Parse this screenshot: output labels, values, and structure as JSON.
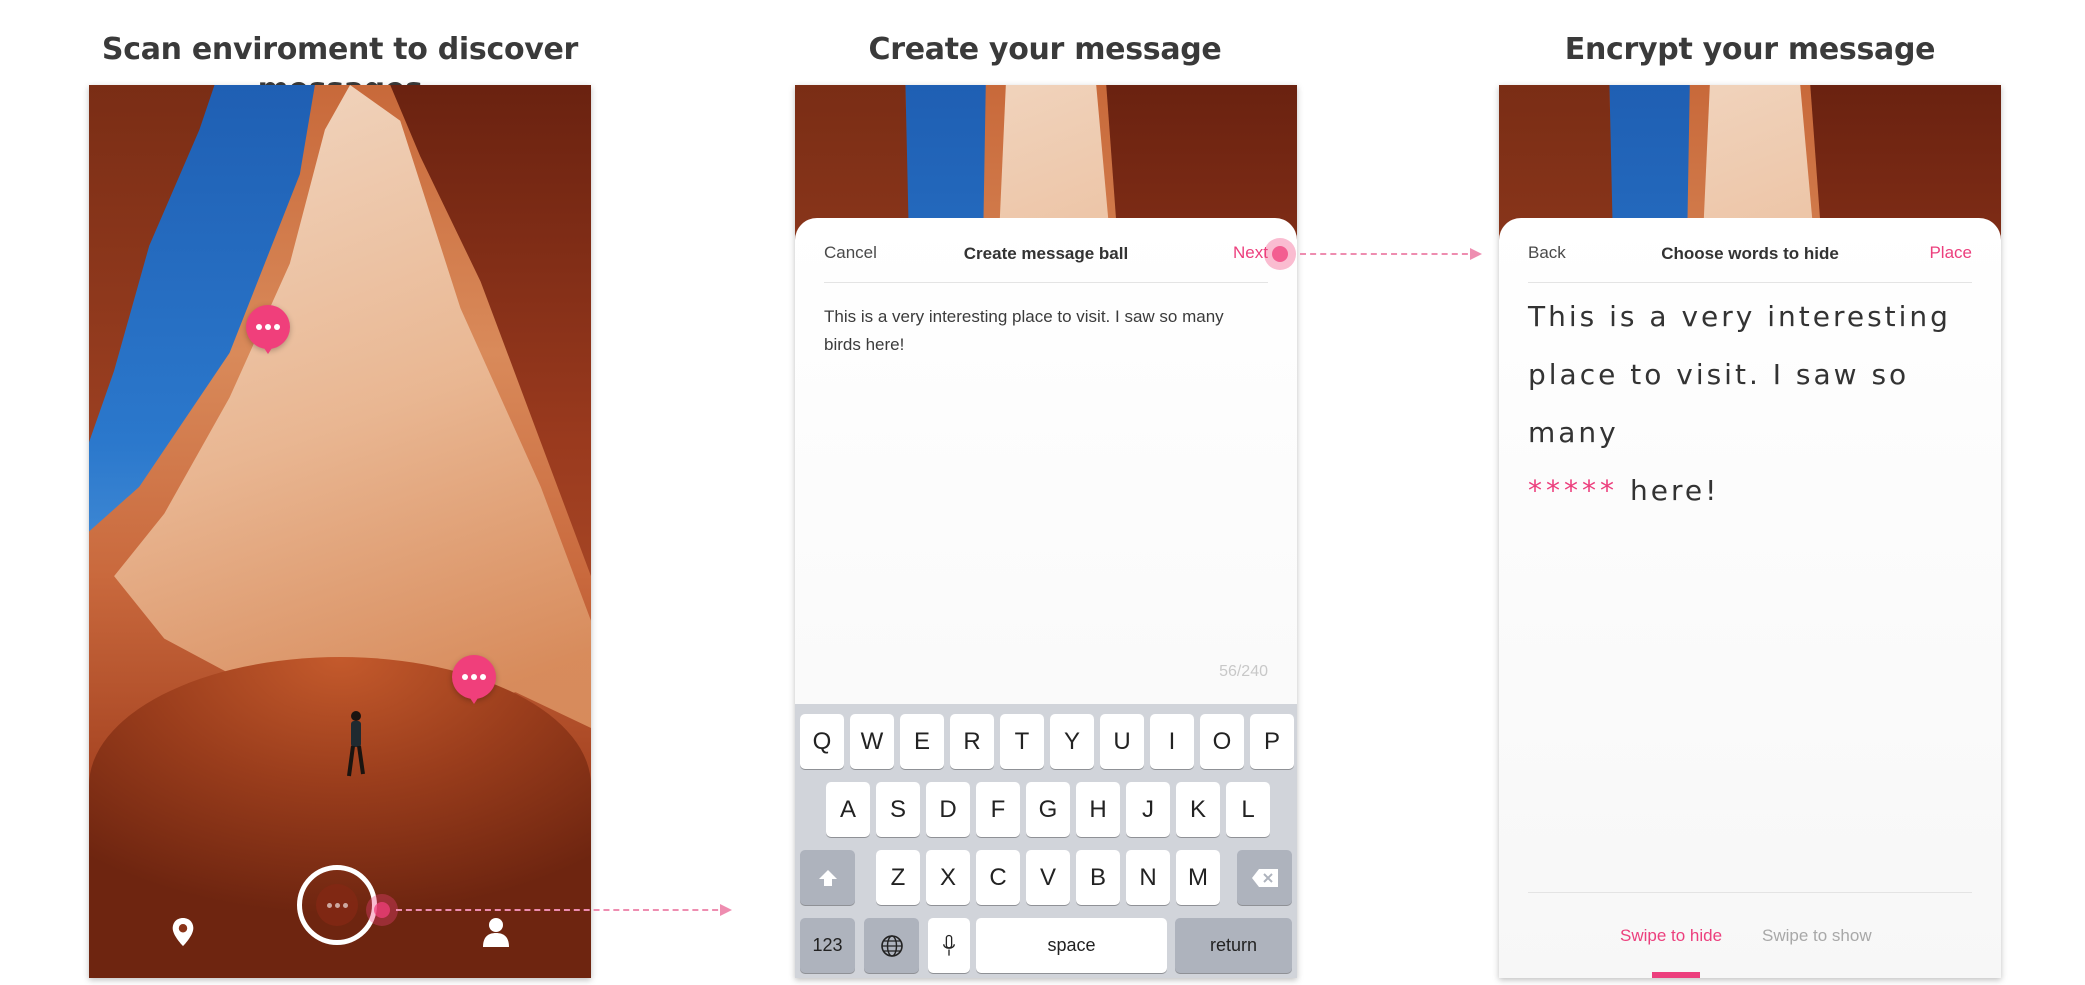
{
  "section_titles": {
    "scan": "Scan enviroment to discover messages",
    "create": "Create your message",
    "encrypt": "Encrypt your message"
  },
  "icons": {
    "location": "location-pin-icon",
    "camera": "camera-shutter-icon",
    "profile": "profile-icon",
    "message_pin": "message-bubble-icon"
  },
  "colors": {
    "accent": "#ec3f7d",
    "keyboard_bg": "#d1d4da"
  },
  "create_screen": {
    "cancel": "Cancel",
    "title": "Create message ball",
    "next": "Next",
    "message": "This is a very interesting place to visit. I saw so many birds here!",
    "counter": "56/240"
  },
  "keyboard": {
    "row1": [
      "Q",
      "W",
      "E",
      "R",
      "T",
      "Y",
      "U",
      "I",
      "O",
      "P"
    ],
    "row2": [
      "A",
      "S",
      "D",
      "F",
      "G",
      "H",
      "J",
      "K",
      "L"
    ],
    "row3": [
      "Z",
      "X",
      "C",
      "V",
      "B",
      "N",
      "M"
    ],
    "numbers": "123",
    "space": "space",
    "return": "return"
  },
  "encrypt_screen": {
    "back": "Back",
    "title": "Choose words to hide",
    "place": "Place",
    "text_line1": "This is a very interesting",
    "text_line2": "place to visit. I saw so many",
    "hidden": "*****",
    "text_line3": "here!",
    "tab_hide": "Swipe to hide",
    "tab_show": "Swipe to show"
  }
}
